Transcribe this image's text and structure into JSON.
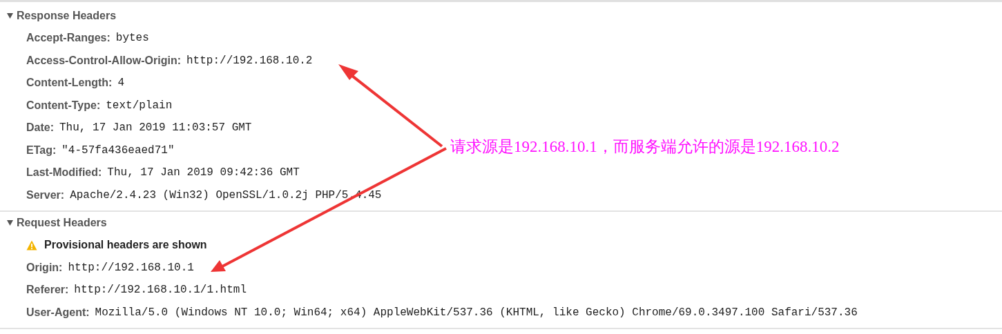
{
  "sections": [
    {
      "title": "Response Headers",
      "expanded": true,
      "rows": [
        {
          "kind": "header",
          "name": "Accept-Ranges:",
          "value": "bytes"
        },
        {
          "kind": "header",
          "name": "Access-Control-Allow-Origin:",
          "value": "http://192.168.10.2"
        },
        {
          "kind": "header",
          "name": "Content-Length:",
          "value": "4"
        },
        {
          "kind": "header",
          "name": "Content-Type:",
          "value": "text/plain"
        },
        {
          "kind": "header",
          "name": "Date:",
          "value": "Thu, 17 Jan 2019 11:03:57 GMT"
        },
        {
          "kind": "header",
          "name": "ETag:",
          "value": "\"4-57fa436eaed71\""
        },
        {
          "kind": "header",
          "name": "Last-Modified:",
          "value": "Thu, 17 Jan 2019 09:42:36 GMT"
        },
        {
          "kind": "header",
          "name": "Server:",
          "value": "Apache/2.4.23 (Win32) OpenSSL/1.0.2j PHP/5.4.45"
        }
      ]
    },
    {
      "title": "Request Headers",
      "expanded": true,
      "rows": [
        {
          "kind": "warning",
          "text": "Provisional headers are shown"
        },
        {
          "kind": "header",
          "name": "Origin:",
          "value": "http://192.168.10.1"
        },
        {
          "kind": "header",
          "name": "Referer:",
          "value": "http://192.168.10.1/1.html"
        },
        {
          "kind": "header",
          "name": "User-Agent:",
          "value": "Mozilla/5.0 (Windows NT 10.0; Win64; x64) AppleWebKit/537.36 (KHTML, like Gecko) Chrome/69.0.3497.100 Safari/537.36"
        }
      ]
    }
  ],
  "annotation": {
    "text": "请求源是192.168.10.1，而服务端允许的源是192.168.10.2"
  }
}
